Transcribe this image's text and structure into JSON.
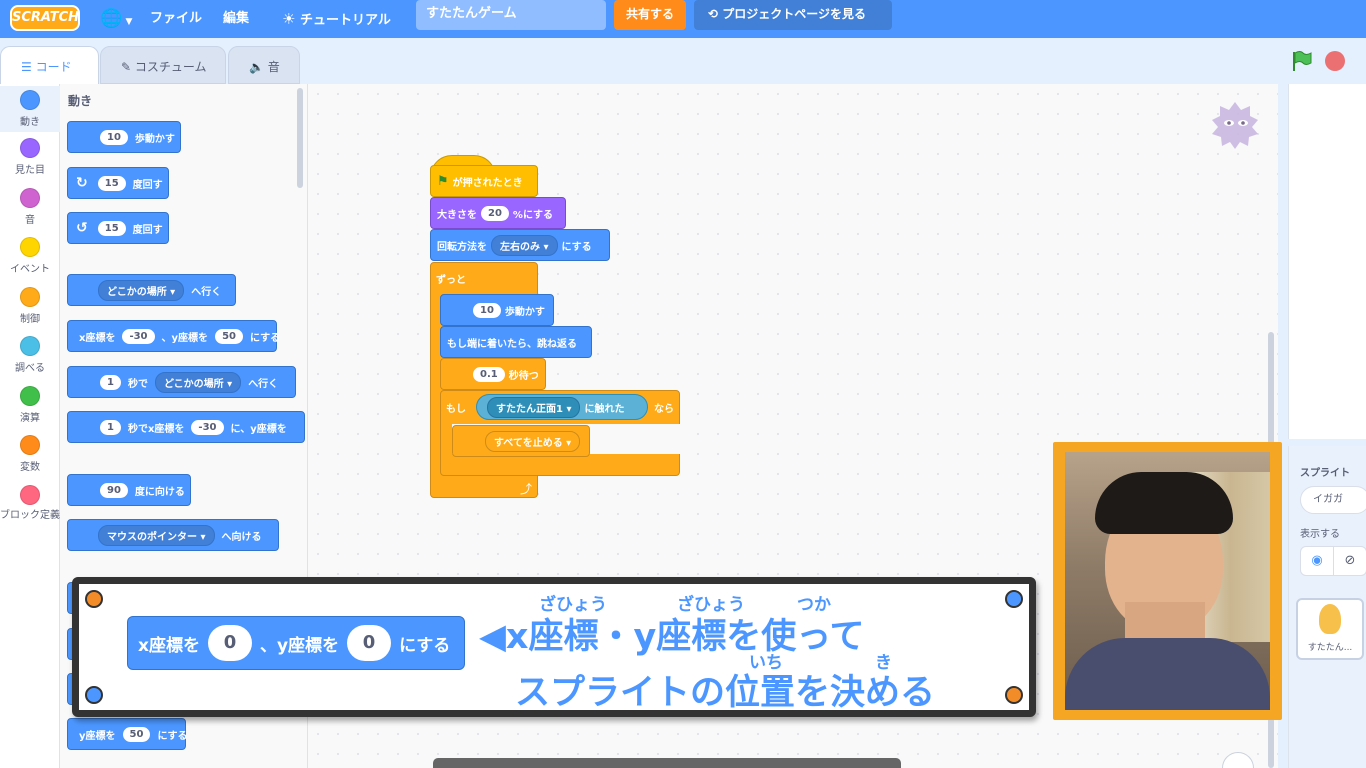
{
  "menubar": {
    "logo": "SCRATCH",
    "globe_icon": "globe-icon",
    "file": "ファイル",
    "edit": "編集",
    "tutorial": "チュートリアル",
    "project_title": "すたたんゲーム",
    "share": "共有する",
    "project_page": "プロジェクトページを見る"
  },
  "tabs": {
    "code": "コード",
    "costume": "コスチューム",
    "sound": "音"
  },
  "categories": [
    {
      "label": "動き",
      "color": "#4c97ff"
    },
    {
      "label": "見た目",
      "color": "#9966ff"
    },
    {
      "label": "音",
      "color": "#cf63cf"
    },
    {
      "label": "イベント",
      "color": "#ffd500"
    },
    {
      "label": "制御",
      "color": "#ffab19"
    },
    {
      "label": "調べる",
      "color": "#4cbfe6"
    },
    {
      "label": "演算",
      "color": "#40bf4a"
    },
    {
      "label": "変数",
      "color": "#ff8c1a"
    },
    {
      "label": "ブロック定義",
      "color": "#ff6680"
    }
  ],
  "palette": {
    "title": "動き",
    "move": {
      "value": "10",
      "text": "歩動かす"
    },
    "turn_right": {
      "value": "15",
      "text": "度回す"
    },
    "turn_left": {
      "value": "15",
      "text": "度回す"
    },
    "goto": {
      "drop": "どこかの場所",
      "text": "へ行く"
    },
    "gotoxy": {
      "t1": "x座標を",
      "x": "-30",
      "t2": "、y座標を",
      "y": "50",
      "t3": "にする"
    },
    "glide": {
      "secs": "1",
      "t1": "秒で",
      "drop": "どこかの場所",
      "t2": "へ行く"
    },
    "glidexy": {
      "secs": "1",
      "t1": "秒でx座標を",
      "x": "-30",
      "t2": "に、y座標を"
    },
    "point_dir": {
      "value": "90",
      "text": "度に向ける"
    },
    "point_towards": {
      "drop": "マウスのポインター",
      "text": "へ向ける"
    },
    "sety": {
      "t1": "y座標を",
      "value": "50",
      "t2": "にする"
    }
  },
  "script": {
    "hat": "が押されたとき",
    "size": {
      "t1": "大きさを",
      "value": "20",
      "t2": "%にする"
    },
    "rotation": {
      "t1": "回転方法を",
      "drop": "左右のみ",
      "t2": "にする"
    },
    "forever": "ずっと",
    "move": {
      "value": "10",
      "text": "歩動かす"
    },
    "bounce": "もし端に着いたら、跳ね返る",
    "wait": {
      "value": "0.1",
      "text": "秒待つ"
    },
    "if": {
      "t1": "もし",
      "t2": "なら"
    },
    "touching": {
      "drop": "すたたん正面1",
      "text": "に触れた"
    },
    "stop": {
      "drop": "すべてを止める"
    }
  },
  "sprite_pane": {
    "sprite_label": "スプライト",
    "sprite_name": "イガガ",
    "show_label": "表示する",
    "thumb_name": "すたたん..."
  },
  "caption": {
    "block": {
      "t1": "x座標を",
      "x": "0",
      "t2": "、y座標を",
      "y": "0",
      "t3": "にする"
    },
    "line1": "◀x座標・y座標を使って",
    "line2": "スプライトの位置を決める",
    "ruby1": "ざひょう",
    "ruby2": "ざひょう",
    "ruby3": "つか",
    "ruby4": "いち",
    "ruby5": "き"
  }
}
